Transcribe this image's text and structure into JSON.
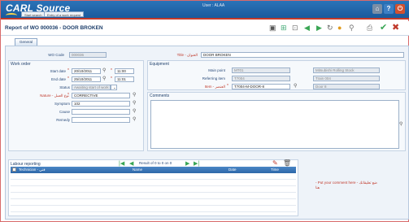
{
  "app": {
    "name": "CARL Source",
    "user_label": "User : ALAA"
  },
  "topbar": {
    "btn1": "Start search",
    "btn2": "Entry of a work request"
  },
  "page": {
    "title": "Report of WO 000036 - DOOR BROKEN"
  },
  "tabs": [
    {
      "label": "General"
    }
  ],
  "header": {
    "wo_code_label": "WO Code",
    "wo_code_value": "000036",
    "title_label": "Title - العنوان",
    "title_value": "DOOR BROKEN"
  },
  "work_order": {
    "section_title": "Work order",
    "start_label": "Start date",
    "start_date": "20/10/2011",
    "start_time": "11:00",
    "end_label": "End date",
    "end_date": "25/10/2011",
    "end_time": "11:01",
    "status_label": "Status",
    "status_value": "Awaiting start of work",
    "nature_label": "Nature - نوع العمل",
    "nature_value": "CORRECTIVE",
    "symptom_label": "Symptom",
    "symptom_value": "102",
    "cause_label": "Cause",
    "cause_value": "",
    "remedy_label": "Remedy",
    "remedy_value": ""
  },
  "equipment": {
    "section_title": "Equipment",
    "main_point_label": "Main point",
    "main_point_code": "MT01",
    "main_point_desc": "Mitsubishi Rolling Stock",
    "referring_label": "Referring item",
    "referring_code": "T7004",
    "referring_desc": "Train 004",
    "item_label": "Item - العنصر",
    "item_code": "T7004-M-DOOR-8",
    "item_desc": "Door 8"
  },
  "comments": {
    "label": "Comments",
    "hint": "- Put your comment here - ضع تعليقاتك هنا"
  },
  "labour": {
    "title": "Labour reporting",
    "pager": "Result of 0 to 0 on 0",
    "columns": [
      "Technician - فني",
      "Name",
      "Date",
      "Time"
    ]
  },
  "colors": {
    "brand_blue": "#1a5a9c",
    "accent_red": "#c0392b"
  }
}
